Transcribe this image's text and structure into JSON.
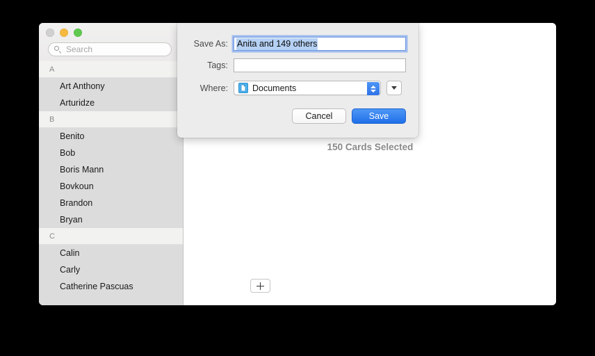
{
  "window": {
    "traffic_lights": [
      {
        "name": "close",
        "color": "#d0d0d0"
      },
      {
        "name": "minimize",
        "color": "#f6b93f"
      },
      {
        "name": "zoom",
        "color": "#5ec84f"
      }
    ]
  },
  "sidebar": {
    "search": {
      "placeholder": "Search",
      "value": ""
    },
    "sections": [
      {
        "letter": "A",
        "contacts": [
          "Art Anthony",
          "Arturidze"
        ]
      },
      {
        "letter": "B",
        "contacts": [
          "Benito",
          "Bob",
          "Boris Mann",
          "Bovkoun",
          "Brandon",
          "Bryan"
        ]
      },
      {
        "letter": "C",
        "contacts": [
          "Calin",
          "Carly",
          "Catherine Pascuas"
        ]
      }
    ]
  },
  "detail": {
    "cards_selected": "150 Cards Selected",
    "add_label": "+"
  },
  "save_sheet": {
    "save_as_label": "Save As:",
    "save_as_value": "Anita and 149 others",
    "tags_label": "Tags:",
    "tags_value": "",
    "where_label": "Where:",
    "where_value": "Documents",
    "cancel_label": "Cancel",
    "save_label": "Save"
  },
  "colors": {
    "accent_blue": "#2f73e8",
    "selection_blue": "#b5d1f4",
    "sidebar_gray": "#dcdcdc",
    "sheet_gray": "#ececec"
  }
}
